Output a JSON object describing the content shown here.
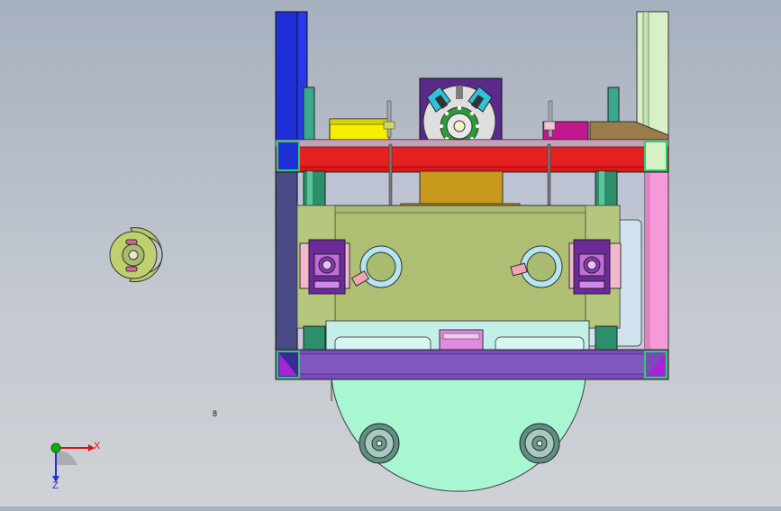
{
  "viewport": {
    "view_label": "8",
    "axes": {
      "x_label": "X",
      "z_label": "Z"
    }
  },
  "colors": {
    "background_top": "#a7b0bf",
    "background_bottom": "#cfd2d6",
    "red_beam": "#e01515",
    "purple_beam": "#7a4bb8",
    "olive_block": "#a9bb6f",
    "mint_plate": "#a8f6d2",
    "blue_post": "#1f2fd8",
    "pale_green_post": "#d7f0c6",
    "pink_panel": "#f49ad8",
    "gold_block": "#c9991d",
    "teal_pillar": "#2d8f6a",
    "x_axis": "#e01010",
    "y_axis": "#10b010",
    "z_axis": "#2030d0"
  },
  "icons": [
    "triad-icon",
    "ring-part-icon"
  ]
}
